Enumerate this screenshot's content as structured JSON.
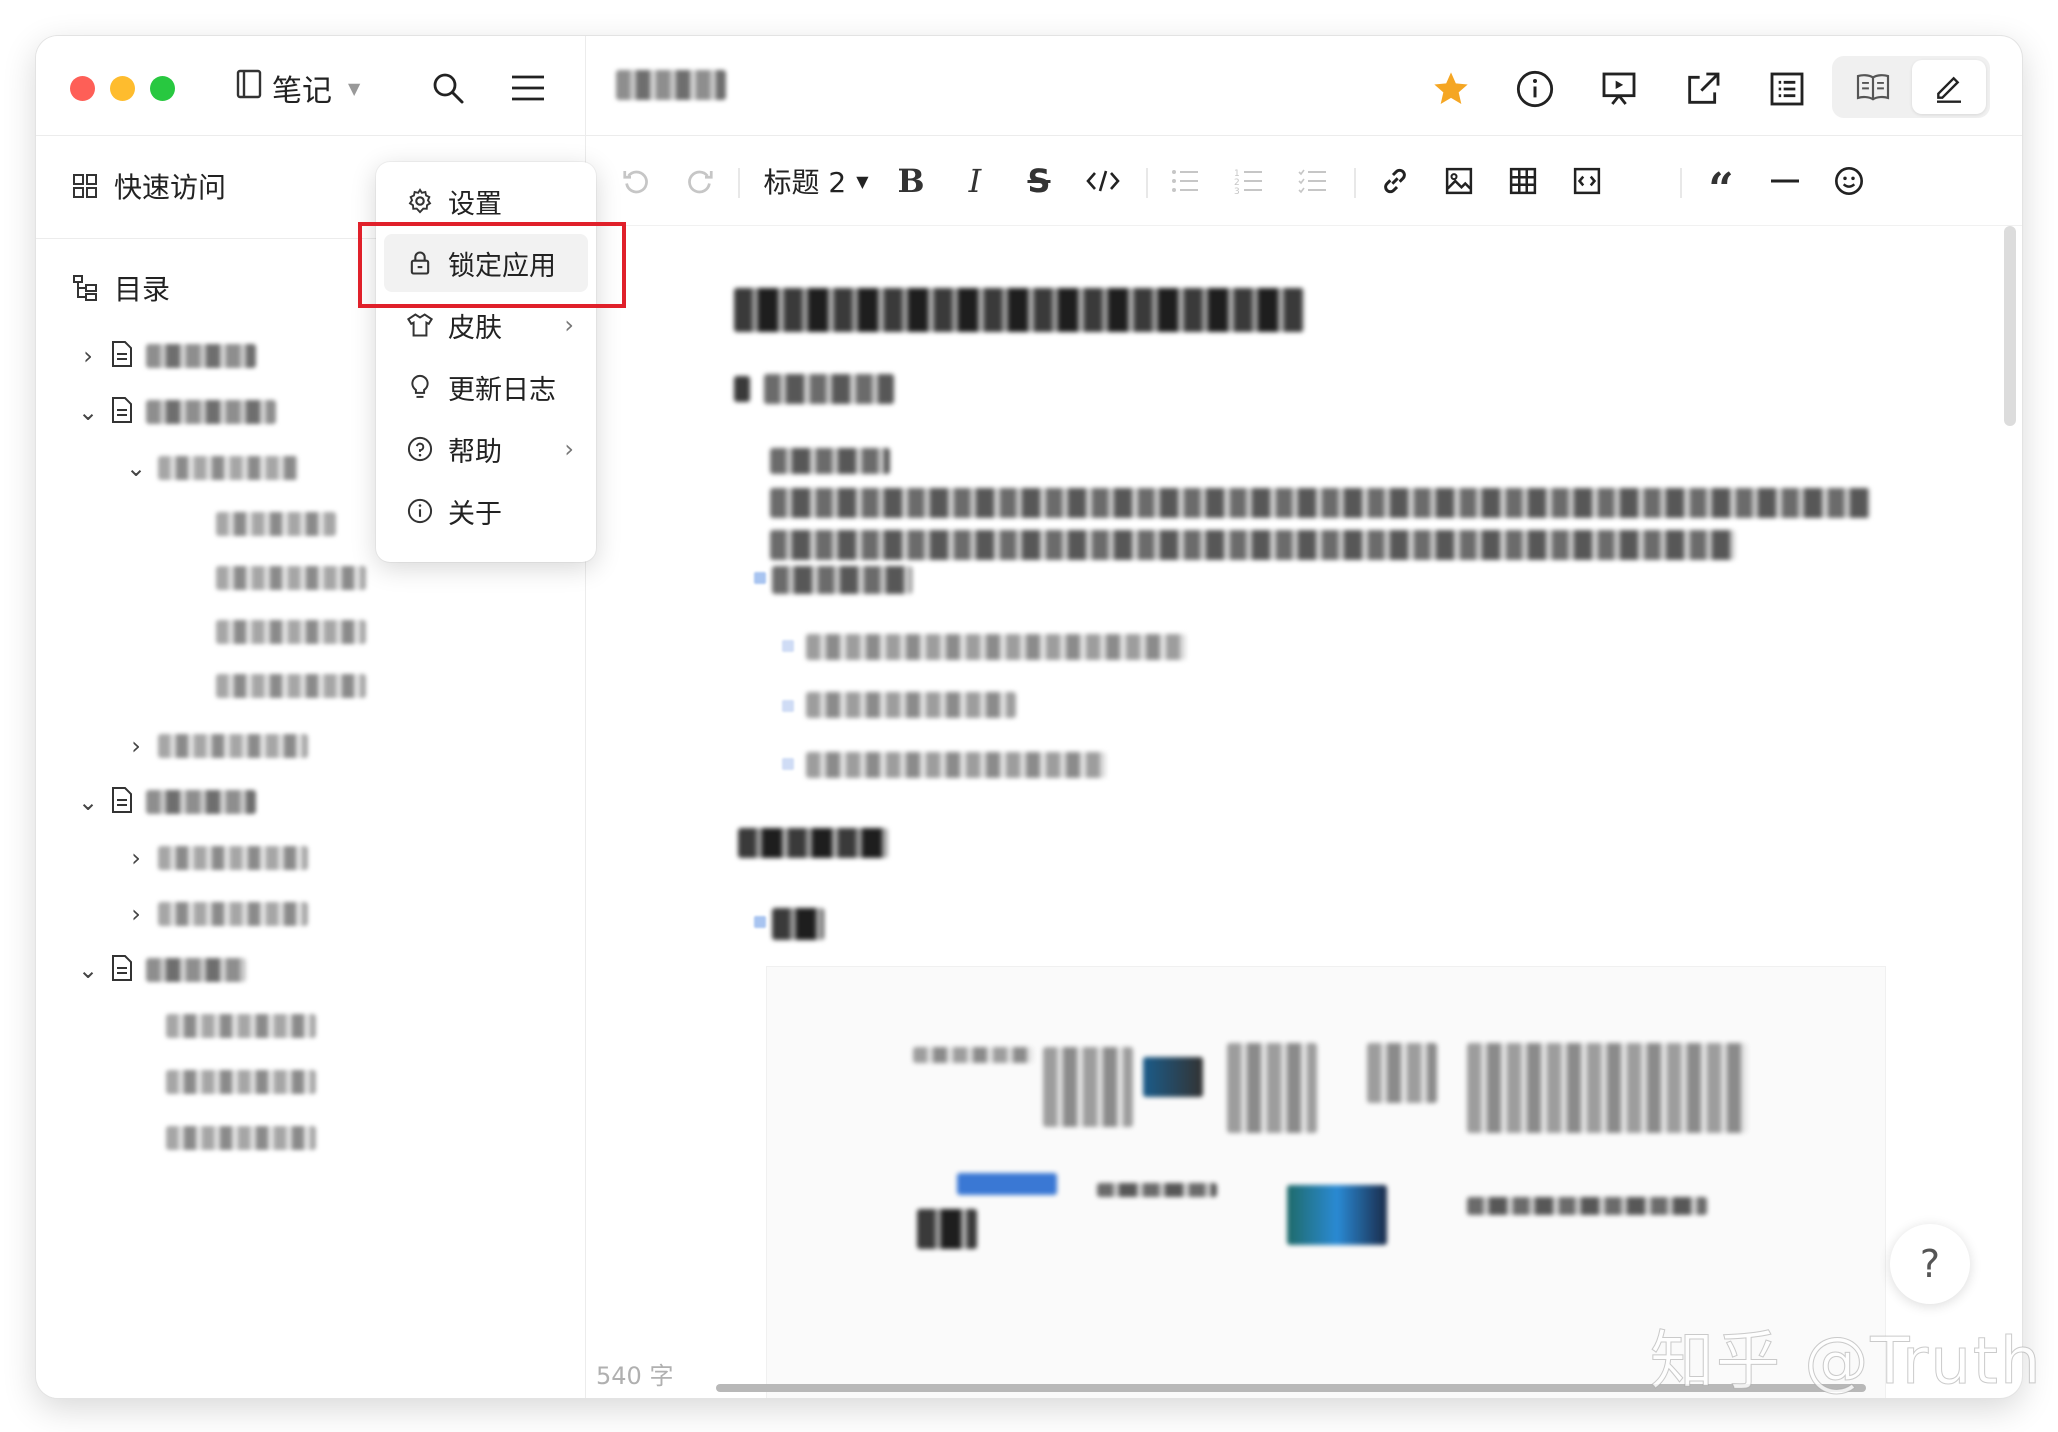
{
  "notebook": {
    "name": "笔记"
  },
  "sidebar": {
    "quick_access": "快速访问",
    "toc_title": "目录"
  },
  "menu": {
    "items": [
      {
        "label": "设置",
        "icon": "gear-icon"
      },
      {
        "label": "锁定应用",
        "icon": "lock-icon"
      },
      {
        "label": "皮肤",
        "icon": "shirt-icon",
        "has_submenu": true
      },
      {
        "label": "更新日志",
        "icon": "lightbulb-icon"
      },
      {
        "label": "帮助",
        "icon": "question-circle-icon",
        "has_submenu": true
      },
      {
        "label": "关于",
        "icon": "info-circle-icon"
      }
    ],
    "highlighted_item": "锁定应用",
    "highlight_color": "#e0202a"
  },
  "toolbar": {
    "heading_label": "标题 2"
  },
  "status": {
    "word_count": "540 字"
  },
  "help_button": {
    "label": "?"
  },
  "watermark": {
    "text": "知乎 @Truth"
  },
  "colors": {
    "star": "#f5a623",
    "traffic_red": "#fe5f57",
    "traffic_yellow": "#febc2e",
    "traffic_green": "#28c840"
  }
}
